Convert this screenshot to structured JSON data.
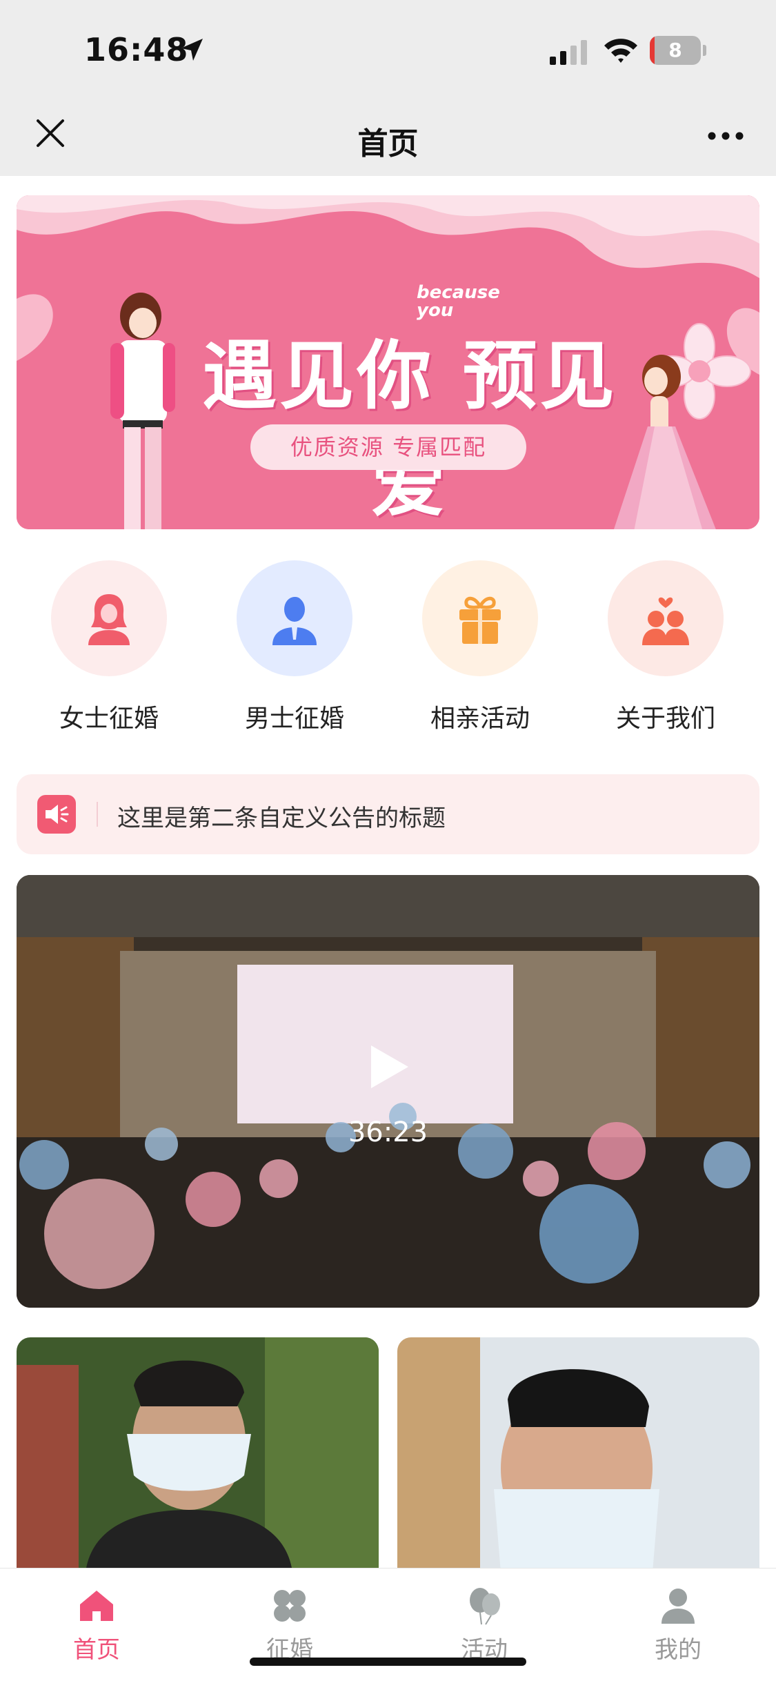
{
  "status_bar": {
    "time": "16:48",
    "battery": "8",
    "battery_level": 0.08
  },
  "nav": {
    "title": "首页"
  },
  "banner": {
    "title": "遇见你 预见爱",
    "en_text_1": "because",
    "en_text_2": "you",
    "tagline": "优质资源  专属匹配"
  },
  "menu": [
    {
      "label": "女士征婚",
      "icon": "woman-icon",
      "bg": "#fdecec",
      "color": "#f05d6b"
    },
    {
      "label": "男士征婚",
      "icon": "man-icon",
      "bg": "#e3ebff",
      "color": "#4d7df0"
    },
    {
      "label": "相亲活动",
      "icon": "gift-icon",
      "bg": "#fff1e3",
      "color": "#f6a03a"
    },
    {
      "label": "关于我们",
      "icon": "couple-icon",
      "bg": "#fde9e5",
      "color": "#f46a4f"
    }
  ],
  "notice": {
    "icon": "speaker-icon",
    "text": "这里是第二条自定义公告的标题"
  },
  "video": {
    "duration": "36:23",
    "icon": "play-icon"
  },
  "tabbar": {
    "tabs": [
      {
        "label": "首页",
        "icon": "home-icon",
        "active": true
      },
      {
        "label": "征婚",
        "icon": "clover-icon",
        "active": false
      },
      {
        "label": "活动",
        "icon": "balloon-icon",
        "active": false
      },
      {
        "label": "我的",
        "icon": "user-icon",
        "active": false
      }
    ]
  },
  "colors": {
    "accent": "#f0527a",
    "banner_pink": "#ee6f93",
    "nav_bg": "#ededed"
  }
}
